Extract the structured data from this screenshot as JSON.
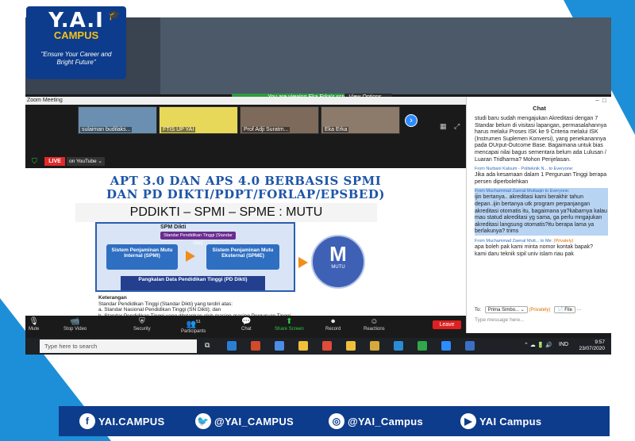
{
  "logo": {
    "name": "Y.A.I",
    "sub": "CAMPUS",
    "tagline_1": "\"Ensure Your Career and",
    "tagline_2": "Bright Future\""
  },
  "zoom": {
    "viewing_banner": "You are viewing Eka Erka's screen",
    "view_options": "View Options ⌄",
    "window_title": "Zoom Meeting",
    "participants": [
      {
        "name": "sulaiman budilaks..."
      },
      {
        "name": "FTIS UP YAI"
      },
      {
        "name": "Prof Adji Suratm..."
      },
      {
        "name": "Eka Erka"
      }
    ],
    "live_label": "LIVE",
    "live_platform": "on YouTube ⌄",
    "slide": {
      "title_line1": "APT 3.0 DAN APS 4.0 BERBASIS SPMI",
      "title_line2": "DAN PD DIKTI/PDPT/FORLAP/EPSBED)",
      "subtitle": "PDDIKTI – SPMI – SPME : MUTU",
      "spm_title": "SPM Dikti",
      "snd_label": "Standar Pendidikan Tinggi (Standar Dikti)",
      "spmi_label": "Sistem Penjaminan Mutu Internal (SPMI)",
      "spme_label": "Sistem Penjaminan Mutu Eksternal (SPME)",
      "pddikti_label": "Pangkalan Data Pendidikan Tinggi (PD Dikti)",
      "mutu_letter": "M",
      "mutu_word": "MUTU",
      "ket_title": "Keterangan",
      "ket_line1": "Standar Pendidikan Tinggi (Standar Dikti) yang terdiri atas:",
      "ket_a": "a.   Standar Nasional Pendidikan Tinggi (SN Dikti); dan",
      "ket_b": "b.   Standar Pendidikan Tinggi yang ditetapkan oleh masing-masing Perguruan Tinggi"
    },
    "toolbar": {
      "mute": "Mute",
      "stop_video": "Stop Video",
      "security": "Security",
      "participants": "Participants",
      "participants_count": "51",
      "chat": "Chat",
      "share_screen": "Share Screen",
      "record": "Record",
      "reactions": "Reactions",
      "leave": "Leave"
    },
    "chat": {
      "header": "Chat",
      "msg0": "studi baru sudah mengajukan Akreditasi dengan 7 Standar belum di visitasi lapangan, permasalahannya harus melalui Proses ISK ke 9 Criteria melalui ISK (Instrumen Suplemen Konversi), yang penekanannya pada OUrput-Outcome Base. Bagaimana untuk bias mencapai nilai bagus sementara belum ada Lulusan / Luaran Tridharma? Mohon Penjelasan.",
      "from1": "From Nurbani Kalsum - Politeknik N...  to  Everyone:",
      "msg1": "Jika ada kesamaan dalam 1 Perguruan Tinggi berapa persen diperbolehkan",
      "from2": "From Muchammad Zaenal Muttaqin  to  Everyone:",
      "msg2": "ijin bertanya.. akreditasi kami berakhir tahun depan..ijin bertanya utk program perpanjangan akreditasi otomatis itu, bagaimana ya?kabarnya kalau mau statud akreditasi yg sama, ga perlu mngajukan akreditasi langsung otomatis?itu berapa lama ya berlakunya? trims",
      "from3_a": "From Muchammad Zaenal Mutt...  to  Me:",
      "from3_b": "(Privately)",
      "msg3a": "apa boleh pak kami minta nomor kontak bapak?",
      "msg3b": "kami daru teknik sipil univ islam riau pak",
      "to_label": "To:",
      "to_name": "Prima Simbo... ⌄",
      "to_private": "(Privately)",
      "file_label": "File",
      "placeholder": "Type message here..."
    }
  },
  "taskbar": {
    "search_placeholder": "Type here to search",
    "lang": "IND",
    "time": "9:57",
    "date": "23/07/2020"
  },
  "social": {
    "facebook": "YAI.CAMPUS",
    "twitter": "@YAI_CAMPUS",
    "instagram": "@YAI_Campus",
    "youtube": "YAI Campus"
  },
  "colors": {
    "brand_blue": "#0e3c8c",
    "accent_blue": "#1c8fd8",
    "zoom_green": "#2e9c3e",
    "leave_red": "#e02020"
  }
}
